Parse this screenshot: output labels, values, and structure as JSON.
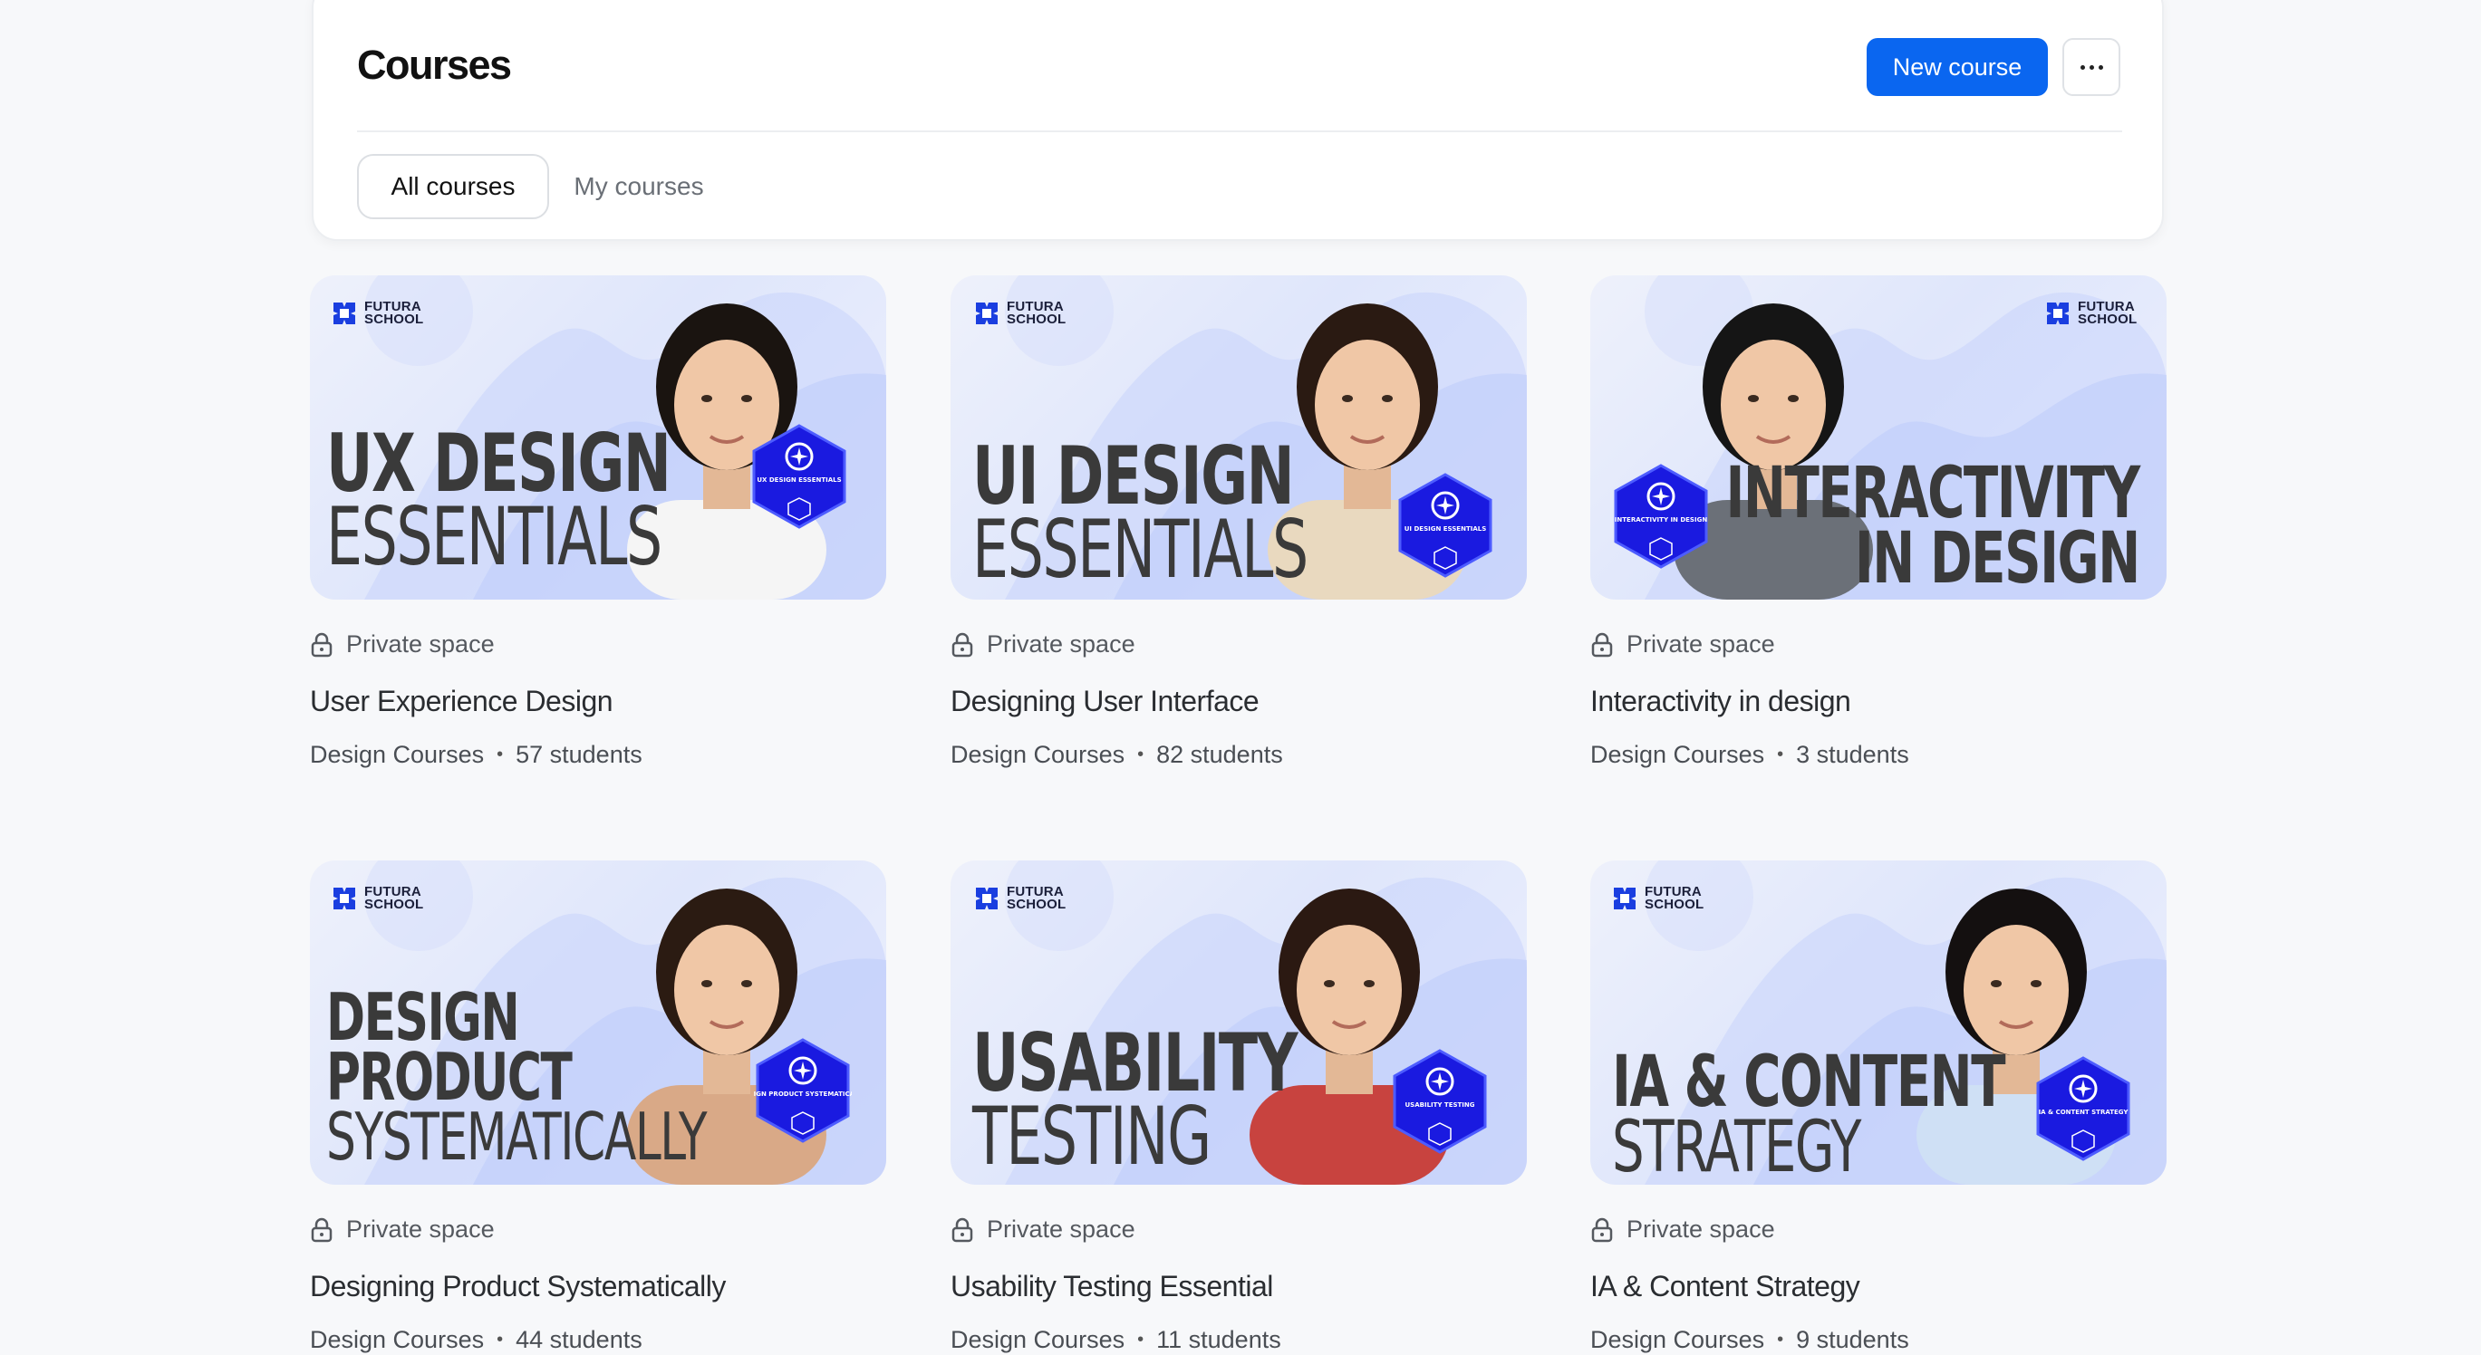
{
  "header": {
    "title": "Courses",
    "new_course_label": "New course",
    "more_icon": "more-horizontal-icon",
    "tabs": [
      {
        "label": "All courses",
        "active": true
      },
      {
        "label": "My courses",
        "active": false
      }
    ]
  },
  "brand": {
    "line1": "FUTURA",
    "line2": "SCHOOL"
  },
  "colors": {
    "accent": "#0a66f0",
    "badge": "#1a1ae0",
    "background": "#f7f8fa"
  },
  "courses": [
    {
      "thumb_line1": "UX DESIGN",
      "thumb_line2": "ESSENTIALS",
      "badge_text": "UX DESIGN ESSENTIALS",
      "privacy": "Private space",
      "title": "User Experience Design",
      "category": "Design Courses",
      "students": "57 students"
    },
    {
      "thumb_line1": "UI DESIGN",
      "thumb_line2": "ESSENTIALS",
      "badge_text": "UI DESIGN ESSENTIALS",
      "privacy": "Private space",
      "title": "Designing User Interface",
      "category": "Design Courses",
      "students": "82 students"
    },
    {
      "thumb_line1": "INTERACTIVITY",
      "thumb_line2": "IN DESIGN",
      "badge_text": "INTERACTIVITY IN DESIGN",
      "privacy": "Private space",
      "title": "Interactivity in design",
      "category": "Design Courses",
      "students": "3 students"
    },
    {
      "thumb_line1": "DESIGN",
      "thumb_line2": "PRODUCT",
      "thumb_line3": "SYSTEMATICALLY",
      "badge_text": "DESIGN PRODUCT SYSTEMATICALLY",
      "privacy": "Private space",
      "title": "Designing Product Systematically",
      "category": "Design Courses",
      "students": "44 students"
    },
    {
      "thumb_line1": "USABILITY",
      "thumb_line2": "TESTING",
      "badge_text": "USABILITY TESTING",
      "privacy": "Private space",
      "title": "Usability Testing Essential",
      "category": "Design Courses",
      "students": "11 students"
    },
    {
      "thumb_line1": "IA & CONTENT",
      "thumb_line2": "STRATEGY",
      "badge_text": "IA & CONTENT STRATEGY",
      "privacy": "Private space",
      "title": "IA & Content Strategy",
      "category": "Design Courses",
      "students": "9 students"
    }
  ]
}
